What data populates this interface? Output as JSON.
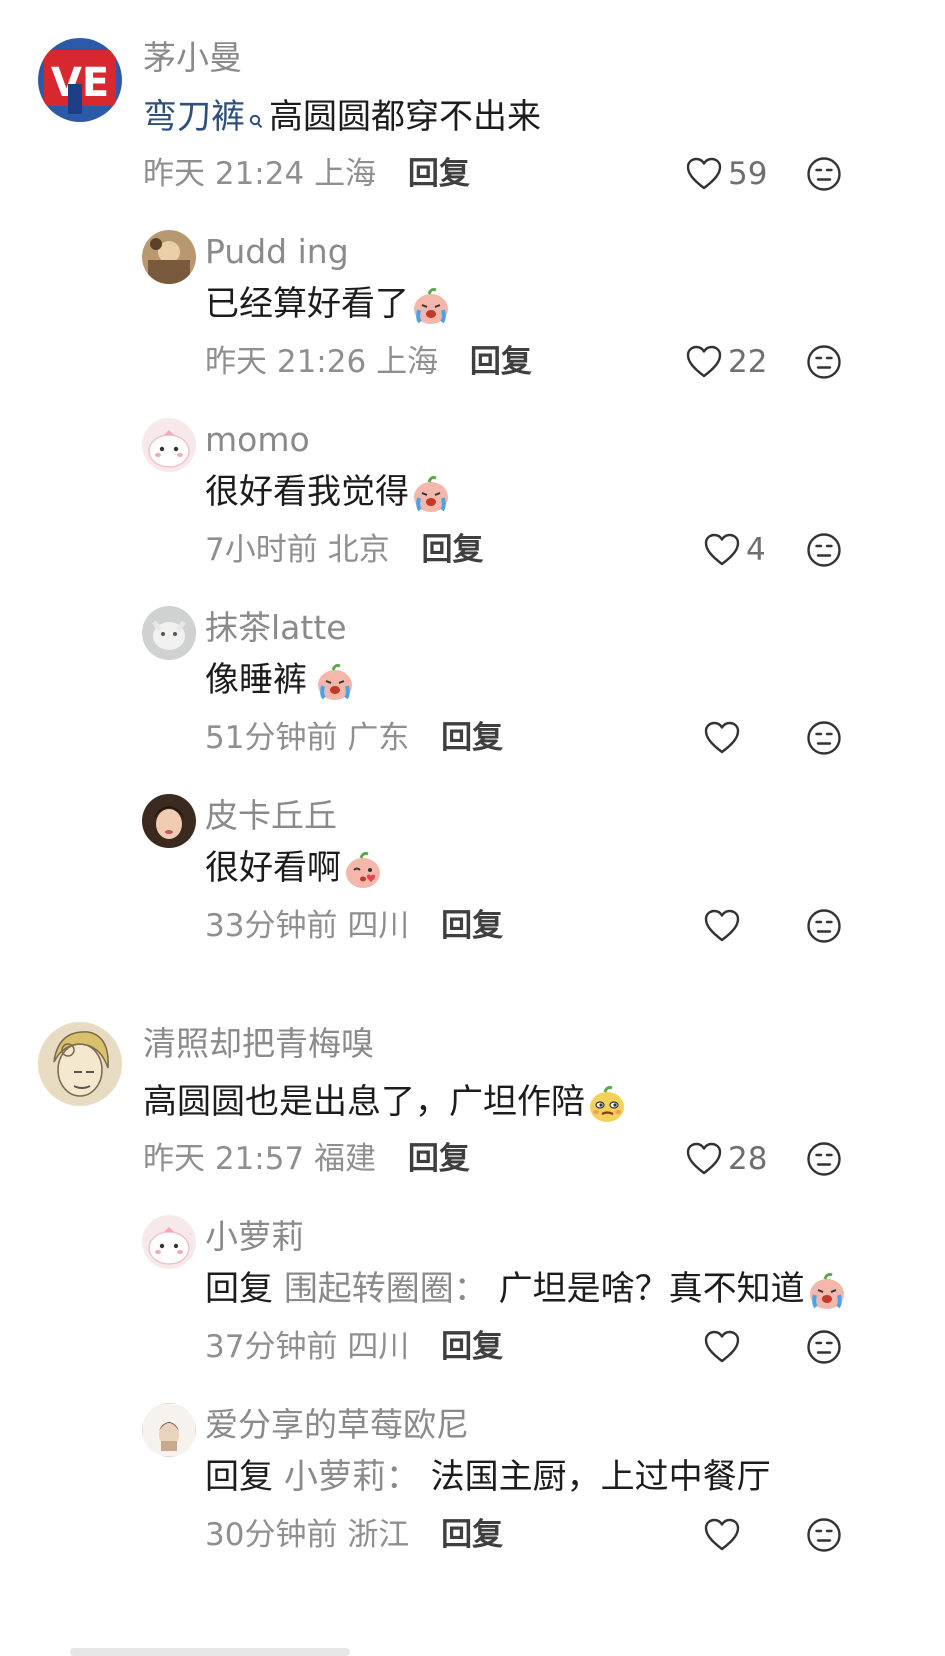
{
  "reply_label": "回复",
  "comments": [
    {
      "user": "茅小曼",
      "link_text": "弯刀裤",
      "text": "高圆圆都穿不出来",
      "time": "昨天 21:24",
      "location": "上海",
      "likes": "59",
      "replies": [
        {
          "user": "Pudd ing",
          "text": "已经算好看了",
          "emoji": "cry",
          "time": "昨天 21:26",
          "location": "上海",
          "likes": "22"
        },
        {
          "user": "momo",
          "text": "很好看我觉得",
          "emoji": "cry",
          "time": "7小时前",
          "location": "北京",
          "likes": "4"
        },
        {
          "user": "抹茶latte",
          "text": "像睡裤",
          "emoji": "cry",
          "time": "51分钟前",
          "location": "广东",
          "likes": ""
        },
        {
          "user": "皮卡丘丘",
          "text": "很好看啊",
          "emoji": "kiss",
          "time": "33分钟前",
          "location": "四川",
          "likes": ""
        }
      ]
    },
    {
      "user": "清照却把青梅嗅",
      "text": "高圆圆也是出息了，广坦作陪",
      "emoji": "smirk",
      "time": "昨天 21:57",
      "location": "福建",
      "likes": "28",
      "replies": [
        {
          "user": "小萝莉",
          "reply_prefix": "回复",
          "reply_to": "围起转圈圈：",
          "text": "广坦是啥？真不知道",
          "emoji": "cry",
          "time": "37分钟前",
          "location": "四川",
          "likes": ""
        },
        {
          "user": "爱分享的草莓欧尼",
          "reply_prefix": "回复",
          "reply_to": "小萝莉：",
          "text": "法国主厨，上过中餐厅",
          "time": "30分钟前",
          "location": "浙江",
          "likes": ""
        }
      ]
    }
  ]
}
